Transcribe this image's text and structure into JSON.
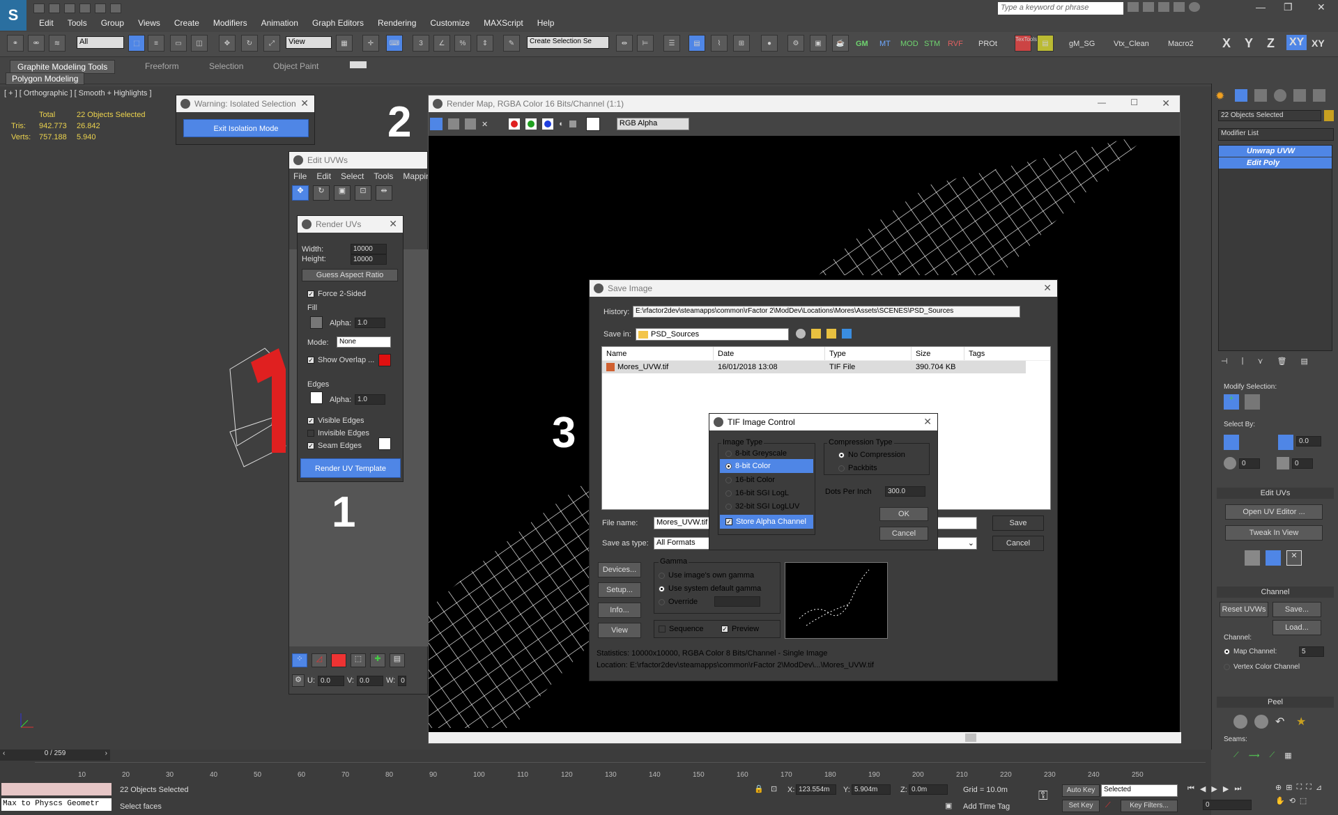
{
  "app": {
    "logo": "3ds Max",
    "menu": [
      "Edit",
      "Tools",
      "Group",
      "Views",
      "Create",
      "Modifiers",
      "Animation",
      "Graph Editors",
      "Rendering",
      "Customize",
      "MAXScript",
      "Help"
    ],
    "search_placeholder": "Type a keyword or phrase",
    "selection_filter": "All",
    "refcoord": "View",
    "named_selection": "Create Selection Se",
    "toolbar_labels": [
      "GM",
      "MT",
      "MOD",
      "STM",
      "RVF",
      "PROt",
      "gM_SG",
      "Vtx_Clean",
      "Macro2"
    ],
    "texttools": "TexTools",
    "axes": [
      "X",
      "Y",
      "Z",
      "XY",
      "XY"
    ]
  },
  "ribbon": {
    "tabs": [
      "Graphite Modeling Tools",
      "Freeform",
      "Selection",
      "Object Paint"
    ],
    "subtab": "Polygon Modeling"
  },
  "viewport": {
    "label": "[ + ] [ Orthographic ] [ Smooth + Highlights ]",
    "total": "Total",
    "selected": "22 Objects Selected",
    "tris_label": "Tris:",
    "tris_total": "942.773",
    "tris_sel": "26.842",
    "verts_label": "Verts:",
    "verts_total": "757.188",
    "verts_sel": "5.940"
  },
  "isolation": {
    "title": "Warning: Isolated Selection",
    "button": "Exit Isolation Mode"
  },
  "edit_uvws": {
    "title": "Edit UVWs",
    "menu": [
      "File",
      "Edit",
      "Select",
      "Tools",
      "Mappin"
    ]
  },
  "render_uvs": {
    "title": "Render UVs",
    "width_label": "Width:",
    "width": "10000",
    "height_label": "Height:",
    "height": "10000",
    "guess": "Guess Aspect Ratio",
    "force": "Force 2-Sided",
    "fill": "Fill",
    "alpha_label": "Alpha:",
    "fill_alpha": "1.0",
    "mode_label": "Mode:",
    "mode": "None",
    "overlap": "Show Overlap ...",
    "edges": "Edges",
    "edge_alpha": "1.0",
    "visible_edges": "Visible Edges",
    "invisible_edges": "Invisible Edges",
    "seam_edges": "Seam Edges",
    "render_btn": "Render UV Template"
  },
  "uv_bottom": {
    "u_label": "U:",
    "u": "0.0",
    "v_label": "V:",
    "v": "0.0",
    "w_label": "W:",
    "w": "0"
  },
  "render_map": {
    "title": "Render Map, RGBA Color 16 Bits/Channel (1:1)",
    "channel": "RGB Alpha"
  },
  "steps": [
    "1",
    "2",
    "3"
  ],
  "save_image": {
    "title": "Save Image",
    "history_label": "History:",
    "history": "E:\\rfactor2dev\\steamapps\\common\\rFactor 2\\ModDev\\Locations\\Mores\\Assets\\SCENES\\PSD_Sources",
    "savein_label": "Save in:",
    "savein": "PSD_Sources",
    "columns": [
      "Name",
      "Date",
      "Type",
      "Size",
      "Tags"
    ],
    "file": {
      "name": "Mores_UVW.tif",
      "date": "16/01/2018 13:08",
      "type": "TIF File",
      "size": "390.704 KB"
    },
    "filename_label": "File name:",
    "filename": "Mores_UVW.tif",
    "saveas_label": "Save as type:",
    "saveas": "All Formats",
    "save_btn": "Save",
    "cancel_btn": "Cancel",
    "devices": "Devices...",
    "setup": "Setup...",
    "info": "Info...",
    "view": "View",
    "gamma": "Gamma",
    "gamma_own": "Use image's own gamma",
    "gamma_sys": "Use system default gamma",
    "gamma_override": "Override",
    "sequence": "Sequence",
    "preview": "Preview",
    "statistics": "Statistics:  10000x10000, RGBA Color 8 Bits/Channel - Single Image",
    "location": "Location:  E:\\rfactor2dev\\steamapps\\common\\rFactor 2\\ModDev\\...\\Mores_UVW.tif"
  },
  "tif": {
    "title": "TIF Image Control",
    "image_type": "Image Type",
    "types": [
      "8-bit Greyscale",
      "8-bit Color",
      "16-bit Color",
      "16-bit SGI LogL",
      "32-bit SGI LogLUV"
    ],
    "alpha": "Store Alpha Channel",
    "compression": "Compression Type",
    "no_comp": "No Compression",
    "packbits": "Packbits",
    "dpi_label": "Dots Per Inch",
    "dpi": "300.0",
    "ok": "OK",
    "cancel": "Cancel"
  },
  "cmdpanel": {
    "selected": "22 Objects Selected",
    "modlist": "Modifier List",
    "stack": [
      "Unwrap UVW",
      "Edit Poly"
    ],
    "modify_selection": "Modify Selection:",
    "select_by": "Select By:",
    "spin1": "0.0",
    "spin2": "0",
    "spin3": "0",
    "edit_uvs": "Edit UVs",
    "open_editor": "Open UV Editor ...",
    "tweak": "Tweak In View",
    "channel": "Channel",
    "reset": "Reset UVWs",
    "save": "Save...",
    "load": "Load...",
    "channel_label": "Channel:",
    "map_channel": "Map Channel:",
    "map_channel_val": "5",
    "vertex_channel": "Vertex Color Channel",
    "peel": "Peel",
    "seams": "Seams:"
  },
  "timeline": {
    "frame": "0 / 259",
    "ticks": [
      "10",
      "20",
      "30",
      "40",
      "50",
      "60",
      "70",
      "80",
      "90",
      "100",
      "110",
      "120",
      "130",
      "140",
      "150",
      "160",
      "170",
      "180",
      "190",
      "200",
      "210",
      "220",
      "230",
      "240",
      "250"
    ],
    "status1": "22 Objects Selected",
    "status2": "Select faces",
    "script": "Max to Physcs Geometr",
    "x_label": "X:",
    "x": "123.554m",
    "y_label": "Y:",
    "y": "5.904m",
    "z_label": "Z:",
    "z": "0.0m",
    "grid": "Grid = 10.0m",
    "add_time_tag": "Add Time Tag",
    "autokey": "Auto Key",
    "setkey": "Set Key",
    "selected": "Selected",
    "keyfilters": "Key Filters...",
    "frame_field": "0"
  }
}
